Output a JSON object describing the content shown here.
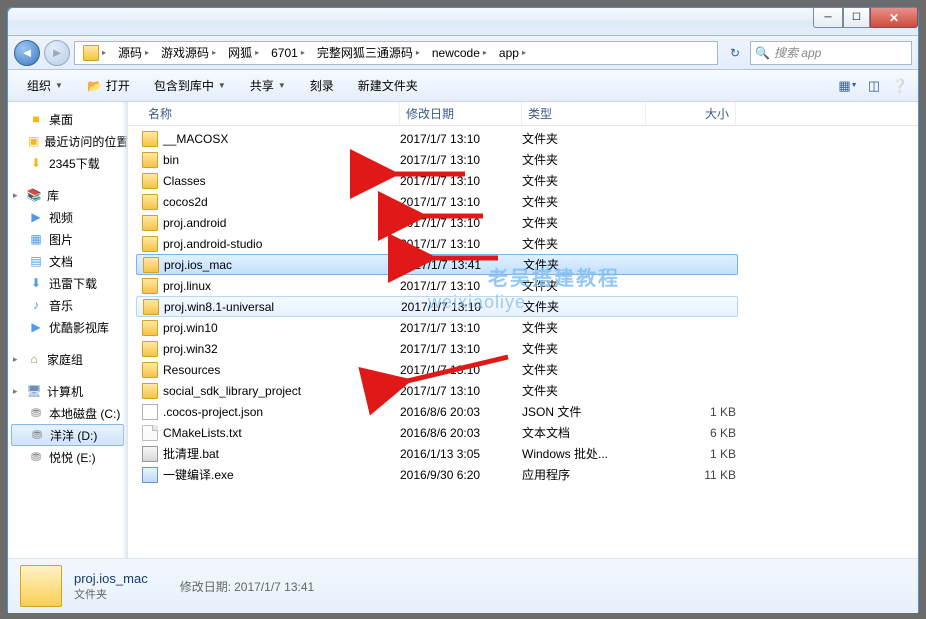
{
  "titlebar": {
    "text1": "",
    "text2": ""
  },
  "breadcrumb": {
    "segments": [
      "源码",
      "游戏源码",
      "网狐",
      "6701",
      "完整网狐三通源码",
      "newcode",
      "app"
    ]
  },
  "search": {
    "placeholder": "搜索 app"
  },
  "toolbar": {
    "organize": "组织",
    "open": "打开",
    "library": "包含到库中",
    "share": "共享",
    "burn": "刻录",
    "newfolder": "新建文件夹"
  },
  "sidebar": {
    "favorites": [
      {
        "icon": "desktop",
        "label": "桌面"
      },
      {
        "icon": "recent",
        "label": "最近访问的位置"
      },
      {
        "icon": "download",
        "label": "2345下载"
      }
    ],
    "libraries_hdr": "库",
    "libraries": [
      {
        "icon": "video",
        "label": "视频"
      },
      {
        "icon": "pic",
        "label": "图片"
      },
      {
        "icon": "doc",
        "label": "文档"
      },
      {
        "icon": "xl",
        "label": "迅雷下载"
      },
      {
        "icon": "music",
        "label": "音乐"
      },
      {
        "icon": "yk",
        "label": "优酷影视库"
      }
    ],
    "homegroup": "家庭组",
    "computer": "计算机",
    "drives": [
      {
        "label": "本地磁盘 (C:)"
      },
      {
        "label": "洋洋 (D:)"
      },
      {
        "label": "悦悦 (E:)"
      }
    ]
  },
  "columns": {
    "name": "名称",
    "date": "修改日期",
    "type": "类型",
    "size": "大小"
  },
  "files": [
    {
      "icon": "folder",
      "name": "__MACOSX",
      "date": "2017/1/7 13:10",
      "type": "文件夹",
      "size": ""
    },
    {
      "icon": "folder",
      "name": "bin",
      "date": "2017/1/7 13:10",
      "type": "文件夹",
      "size": ""
    },
    {
      "icon": "folder",
      "name": "Classes",
      "date": "2017/1/7 13:10",
      "type": "文件夹",
      "size": ""
    },
    {
      "icon": "folder",
      "name": "cocos2d",
      "date": "2017/1/7 13:10",
      "type": "文件夹",
      "size": ""
    },
    {
      "icon": "folder",
      "name": "proj.android",
      "date": "2017/1/7 13:10",
      "type": "文件夹",
      "size": ""
    },
    {
      "icon": "folder",
      "name": "proj.android-studio",
      "date": "2017/1/7 13:10",
      "type": "文件夹",
      "size": ""
    },
    {
      "icon": "folder",
      "name": "proj.ios_mac",
      "date": "2017/1/7 13:41",
      "type": "文件夹",
      "size": "",
      "sel": true
    },
    {
      "icon": "folder",
      "name": "proj.linux",
      "date": "2017/1/7 13:10",
      "type": "文件夹",
      "size": ""
    },
    {
      "icon": "folder",
      "name": "proj.win8.1-universal",
      "date": "2017/1/7 13:10",
      "type": "文件夹",
      "size": "",
      "hi": true
    },
    {
      "icon": "folder",
      "name": "proj.win10",
      "date": "2017/1/7 13:10",
      "type": "文件夹",
      "size": ""
    },
    {
      "icon": "folder",
      "name": "proj.win32",
      "date": "2017/1/7 13:10",
      "type": "文件夹",
      "size": ""
    },
    {
      "icon": "folder",
      "name": "Resources",
      "date": "2017/1/7 13:10",
      "type": "文件夹",
      "size": ""
    },
    {
      "icon": "folder",
      "name": "social_sdk_library_project",
      "date": "2017/1/7 13:10",
      "type": "文件夹",
      "size": ""
    },
    {
      "icon": "json",
      "name": ".cocos-project.json",
      "date": "2016/8/6 20:03",
      "type": "JSON 文件",
      "size": "1 KB"
    },
    {
      "icon": "file",
      "name": "CMakeLists.txt",
      "date": "2016/8/6 20:03",
      "type": "文本文档",
      "size": "6 KB"
    },
    {
      "icon": "bat",
      "name": "批清理.bat",
      "date": "2016/1/13 3:05",
      "type": "Windows 批处...",
      "size": "1 KB"
    },
    {
      "icon": "exe",
      "name": "一键编译.exe",
      "date": "2016/9/30 6:20",
      "type": "应用程序",
      "size": "11 KB"
    }
  ],
  "details": {
    "title": "proj.ios_mac",
    "sub": "文件夹",
    "meta_label": "修改日期:",
    "meta_val": "2017/1/7 13:41"
  },
  "watermark": "老吴搭建教程",
  "watermark2": "weixiaoliye"
}
